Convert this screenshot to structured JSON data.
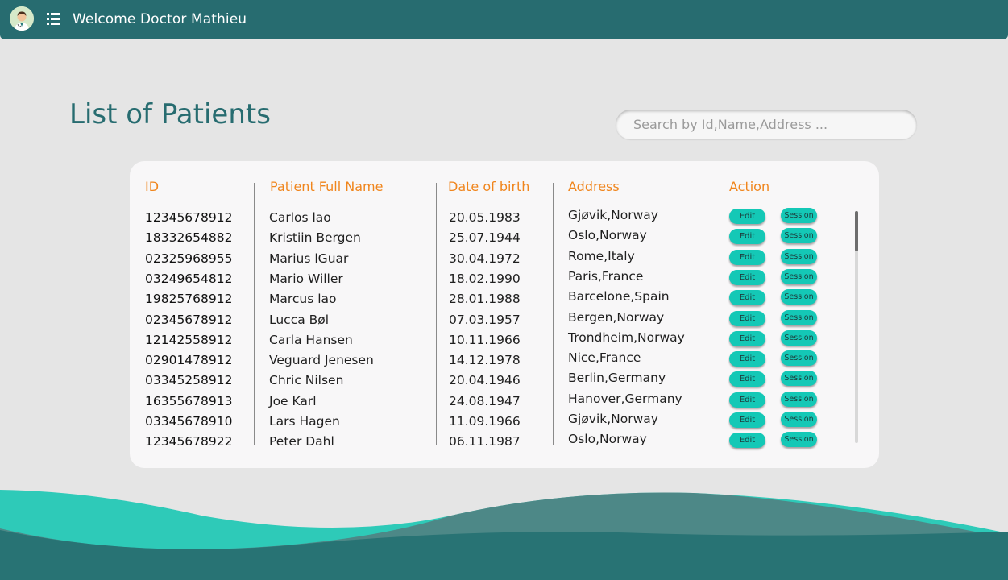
{
  "header": {
    "welcome": "Welcome Doctor Mathieu",
    "avatar_icon": "doctor-avatar-icon",
    "menu_icon": "list-menu-icon"
  },
  "page": {
    "title": "List of Patients"
  },
  "search": {
    "placeholder": "Search by Id,Name,Address ..."
  },
  "table": {
    "columns": {
      "id": "ID",
      "name": "Patient Full Name",
      "dob": "Date of birth",
      "address": "Address",
      "action": "Action"
    },
    "edit_label": "Edit",
    "session_label": "Session",
    "rows": [
      {
        "id": "12345678912",
        "name": "Carlos lao",
        "dob": "20.05.1983",
        "address": "Gjøvik,Norway"
      },
      {
        "id": "18332654882",
        "name": "Kristiin Bergen",
        "dob": "25.07.1944",
        "address": "Oslo,Norway"
      },
      {
        "id": "02325968955",
        "name": "Marius lGuar",
        "dob": "30.04.1972",
        "address": "Rome,Italy"
      },
      {
        "id": "03249654812",
        "name": "Mario Willer",
        "dob": "18.02.1990",
        "address": "Paris,France"
      },
      {
        "id": "19825768912",
        "name": "Marcus lao",
        "dob": "28.01.1988",
        "address": "Barcelone,Spain"
      },
      {
        "id": "02345678912",
        "name": "Lucca Bøl",
        "dob": "07.03.1957",
        "address": "Bergen,Norway"
      },
      {
        "id": "12142558912",
        "name": "Carla Hansen",
        "dob": "10.11.1966",
        "address": "Trondheim,Norway"
      },
      {
        "id": "02901478912",
        "name": "Veguard Jenesen",
        "dob": "14.12.1978",
        "address": "Nice,France"
      },
      {
        "id": "03345258912",
        "name": "Chric Nilsen",
        "dob": "20.04.1946",
        "address": "Berlin,Germany"
      },
      {
        "id": "16355678913",
        "name": "Joe Karl",
        "dob": "24.08.1947",
        "address": "Hanover,Germany"
      },
      {
        "id": "03345678910",
        "name": "Lars Hagen",
        "dob": "11.09.1966",
        "address": "Gjøvik,Norway"
      },
      {
        "id": "12345678922",
        "name": "Peter Dahl",
        "dob": "06.11.1987",
        "address": "Oslo,Norway"
      }
    ]
  },
  "colors": {
    "primary": "#276c70",
    "accent": "#f0851c",
    "button": "#14c8b6",
    "background": "#e5e5e5",
    "wave_light": "#2ecab8",
    "wave_dark": "#4f8484"
  }
}
